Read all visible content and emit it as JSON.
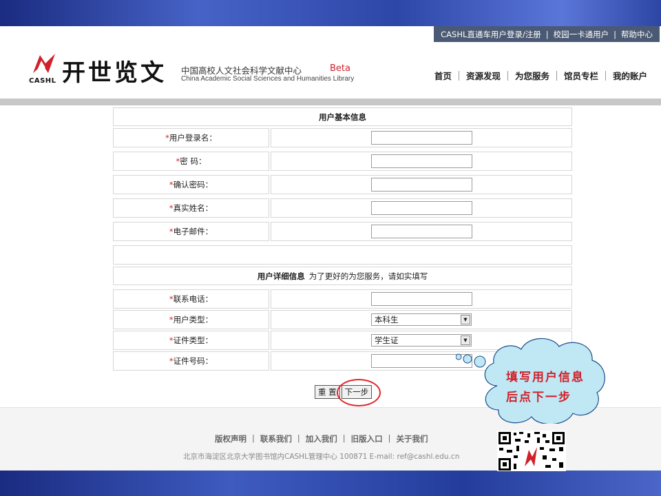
{
  "top_links": {
    "login": "CASHL直通车用户登录/注册",
    "sep1": "|",
    "campus": "校园一卡通用户",
    "sep2": "|",
    "help": "帮助中心"
  },
  "brand": {
    "logo_text": "CASHL",
    "name_cn": "开世览文",
    "sub_cn": "中国高校人文社会科学文献中心",
    "beta": "Beta",
    "sub_en": "China Academic Social Sciences and Humanities Library"
  },
  "nav": [
    "首页",
    "资源发现",
    "为您服务",
    "馆员专栏",
    "我的账户"
  ],
  "form": {
    "basic_title": "用户基本信息",
    "required_mark": "*",
    "fields_basic": [
      {
        "label": "用户登录名：",
        "value": ""
      },
      {
        "label": "密 码：",
        "value": ""
      },
      {
        "label": "确认密码：",
        "value": ""
      },
      {
        "label": "真实姓名：",
        "value": ""
      },
      {
        "label": "电子邮件：",
        "value": ""
      }
    ],
    "detail_title": "用户详细信息",
    "detail_note": "为了更好的为您服务，请如实填写",
    "phone_label": "联系电话：",
    "user_type_label": "用户类型：",
    "user_type_value": "本科生",
    "id_type_label": "证件类型：",
    "id_type_value": "学生证",
    "id_number_label": "证件号码：",
    "reset": "重 置",
    "next": "下一步"
  },
  "footer": {
    "links": [
      "版权声明",
      "联系我们",
      "加入我们",
      "旧版入口",
      "关于我们"
    ],
    "sep": "|",
    "address": "北京市海淀区北京大学图书馆内CASHL管理中心 100871 E-mail: ref@cashl.edu.cn"
  },
  "callout": {
    "line1": "填写用户信息",
    "line2": "后点下一步"
  },
  "colors": {
    "accent_red": "#d0202a",
    "band_blue": "#2d46a4",
    "toplink_bg": "#4b5a74"
  }
}
